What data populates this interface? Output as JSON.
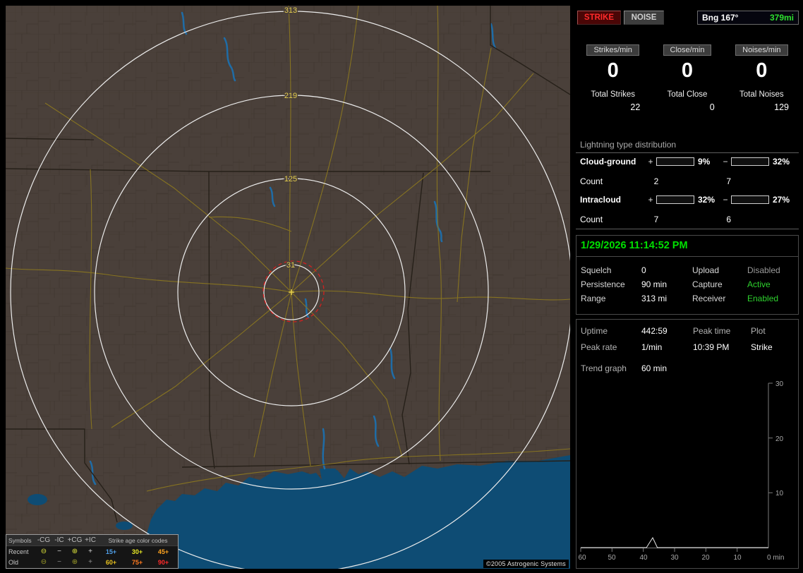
{
  "map": {
    "ring_labels": [
      "313",
      "219",
      "125",
      "31"
    ],
    "copyright": "©2005 Astrogenic Systems",
    "legend": {
      "symbols_header": "Symbols",
      "col_headers": [
        "-CG",
        "-IC",
        "+CG",
        "+IC"
      ],
      "age_header": "Strike age color codes",
      "symbols": [
        "⊖",
        "−",
        "⊕",
        "+"
      ],
      "rows": [
        {
          "label": "Recent",
          "ages": [
            "15+",
            "30+",
            "45+"
          ],
          "age_colors": [
            "#4f9fe8",
            "#e8e825",
            "#ffa31f"
          ]
        },
        {
          "label": "Old",
          "ages": [
            "60+",
            "75+",
            "90+"
          ],
          "age_colors": [
            "#e8c11f",
            "#ff7a1f",
            "#ff2a2a"
          ]
        }
      ]
    }
  },
  "panel": {
    "strike_button": "STRIKE",
    "noise_button": "NOISE",
    "bearing_label": "Bng 167°",
    "bearing_value": "379mi",
    "bearing_value_color": "#2ee02e",
    "counters": [
      {
        "label": "Strikes/min",
        "value": "0",
        "total_label": "Total Strikes",
        "total": "22"
      },
      {
        "label": "Close/min",
        "value": "0",
        "total_label": "Total Close",
        "total": "0"
      },
      {
        "label": "Noises/min",
        "value": "0",
        "total_label": "Total Noises",
        "total": "129"
      }
    ],
    "distribution": {
      "title": "Lightning type distribution",
      "plus_sign": "+",
      "minus_sign": "−",
      "count_label": "Count",
      "rows": [
        {
          "label": "Cloud-ground",
          "plus_pct_text": "9%",
          "plus_pct": 9,
          "plus_color": "#f02020",
          "minus_pct_text": "32%",
          "minus_pct": 32,
          "minus_color": "#5a9cf0",
          "plus_count": "2",
          "minus_count": "7"
        },
        {
          "label": "Intracloud",
          "plus_pct_text": "32%",
          "plus_pct": 32,
          "plus_color": "#f060c8",
          "minus_pct_text": "27%",
          "minus_pct": 27,
          "minus_color": "#28dd28",
          "plus_count": "7",
          "minus_count": "6"
        }
      ]
    },
    "datetime": "1/29/2026 11:14:52 PM",
    "settings": {
      "rows": [
        {
          "label": "Squelch",
          "value": "0",
          "label2": "Upload",
          "value2": "Disabled",
          "value2_color": "#9a9a9a"
        },
        {
          "label": "Persistence",
          "value": "90 min",
          "label2": "Capture",
          "value2": "Active",
          "value2_color": "#2ed22e"
        },
        {
          "label": "Range",
          "value": "313 mi",
          "label2": "Receiver",
          "value2": "Enabled",
          "value2_color": "#2ed22e"
        }
      ]
    },
    "status": {
      "uptime_label": "Uptime",
      "uptime_value": "442:59",
      "peak_time_label": "Peak time",
      "peak_time_value": "10:39 PM",
      "plot_label": "Plot",
      "plot_value": "Strike",
      "peak_rate_label": "Peak rate",
      "peak_rate_value": "1/min",
      "trend_label": "Trend graph",
      "trend_value": "60 min"
    },
    "chart": {
      "type": "line",
      "y_ticks": [
        "30",
        "20",
        "10"
      ],
      "x_ticks": [
        "60",
        "50",
        "40",
        "30",
        "20",
        "10",
        "0 min"
      ],
      "ylim": [
        0,
        30
      ],
      "xlim_minutes_ago": [
        60,
        0
      ],
      "points": [
        [
          60,
          0
        ],
        [
          39,
          0
        ],
        [
          37,
          1.8
        ],
        [
          35.5,
          0
        ],
        [
          0,
          0
        ]
      ]
    }
  }
}
